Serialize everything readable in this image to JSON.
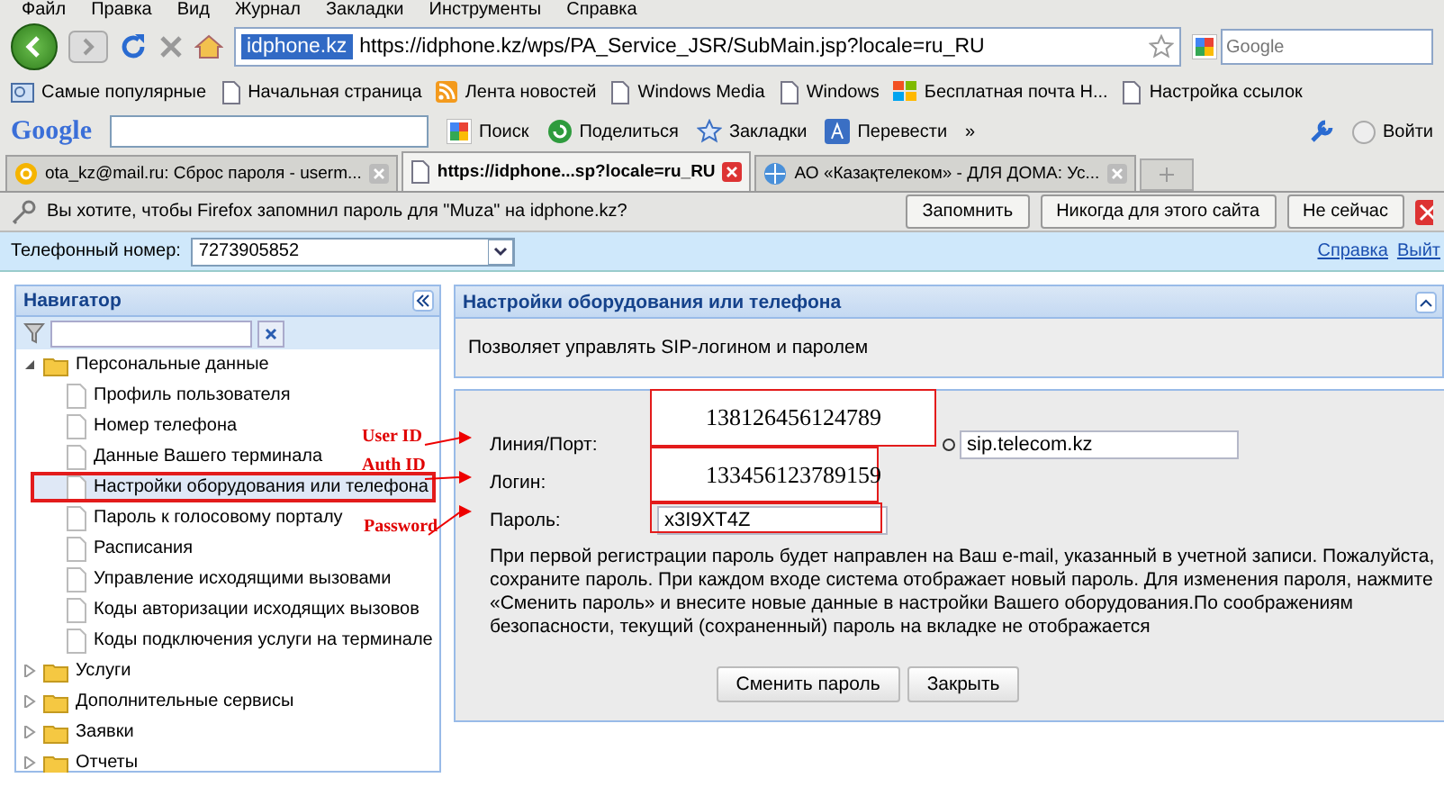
{
  "menu_bar": [
    "Файл",
    "Правка",
    "Вид",
    "Журнал",
    "Закладки",
    "Инструменты",
    "Справка"
  ],
  "navigation": {
    "url_domain": "idphone.kz",
    "url": "https://idphone.kz/wps/PA_Service_JSR/SubMain.jsp?locale=ru_RU",
    "search_placeholder": "Google"
  },
  "bookmarks": [
    {
      "label": "Самые популярные",
      "kind": "special"
    },
    {
      "label": "Начальная страница",
      "kind": "page"
    },
    {
      "label": "Лента новостей",
      "kind": "feed"
    },
    {
      "label": "Windows Media",
      "kind": "page"
    },
    {
      "label": "Windows",
      "kind": "page"
    },
    {
      "label": "Бесплатная почта Н...",
      "kind": "windows"
    },
    {
      "label": "Настройка ссылок",
      "kind": "page"
    }
  ],
  "google_toolbar": {
    "logo": "Google",
    "items": [
      {
        "label": "Поиск",
        "kind": "search"
      },
      {
        "label": "Поделиться",
        "kind": "share"
      },
      {
        "label": "Закладки",
        "kind": "star"
      },
      {
        "label": "Перевести",
        "kind": "translate"
      }
    ],
    "more": "»",
    "login": "Войти"
  },
  "tabs": [
    {
      "label": "ota_kz@mail.ru: Сброс пароля - userm...",
      "selected": false
    },
    {
      "label": "https://idphone...sp?locale=ru_RU",
      "selected": true
    },
    {
      "label": "АО «Казақтелеком» - ДЛЯ ДОМА: Ус...",
      "selected": false
    }
  ],
  "password_prompt": {
    "message": "Вы хотите, чтобы Firefox запомнил пароль для \"Muza\" на idphone.kz?",
    "buttons": [
      "Запомнить",
      "Никогда для этого сайта",
      "Не сейчас"
    ]
  },
  "phone_bar": {
    "label": "Телефонный номер:",
    "value": "7273905852",
    "links": [
      "Справка",
      "Выйт"
    ]
  },
  "navigator": {
    "title": "Навигатор",
    "tree": [
      {
        "label": "Персональные данные",
        "expanded": true,
        "children": [
          {
            "label": "Профиль пользователя",
            "selected": false
          },
          {
            "label": "Номер телефона",
            "selected": false
          },
          {
            "label": "Данные Вашего терминала",
            "selected": false
          },
          {
            "label": "Настройки оборудования или телефона",
            "selected": true
          },
          {
            "label": "Пароль к голосовому порталу",
            "selected": false
          },
          {
            "label": "Расписания",
            "selected": false
          },
          {
            "label": "Управление исходящими вызовами",
            "selected": false
          },
          {
            "label": "Коды авторизации исходящих вызовов",
            "selected": false
          },
          {
            "label": "Коды подключения услуги на терминале",
            "selected": false
          }
        ]
      },
      {
        "label": "Услуги",
        "expanded": false
      },
      {
        "label": "Дополнительные сервисы",
        "expanded": false
      },
      {
        "label": "Заявки",
        "expanded": false
      },
      {
        "label": "Отчеты",
        "expanded": false
      }
    ]
  },
  "panel": {
    "title": "Настройки оборудования или телефона",
    "description": "Позволяет управлять SIP-логином и паролем",
    "fields": [
      {
        "label": "Линия/Порт:",
        "domain": "sip.telecom.kz"
      },
      {
        "label": "Логин:"
      },
      {
        "label": "Пароль:",
        "value": "x3I9XT4Z"
      }
    ],
    "note": "При первой регистрации пароль будет направлен на Ваш e-mail, указанный в учетной записи. Пожалуйста, сохраните пароль. При каждом входе система отображает новый пароль. Для изменения пароля, нажмите «Сменить пароль» и внесите новые данные в настройки Вашего оборудования.По соображениям безопасности, текущий (сохраненный) пароль на вкладке не отображается",
    "buttons": [
      "Сменить пароль",
      "Закрыть"
    ]
  },
  "annotations": [
    {
      "label": "User ID",
      "value": "138126456124789"
    },
    {
      "label": "Auth ID",
      "value": "133456123789159"
    },
    {
      "label": "Password"
    }
  ]
}
